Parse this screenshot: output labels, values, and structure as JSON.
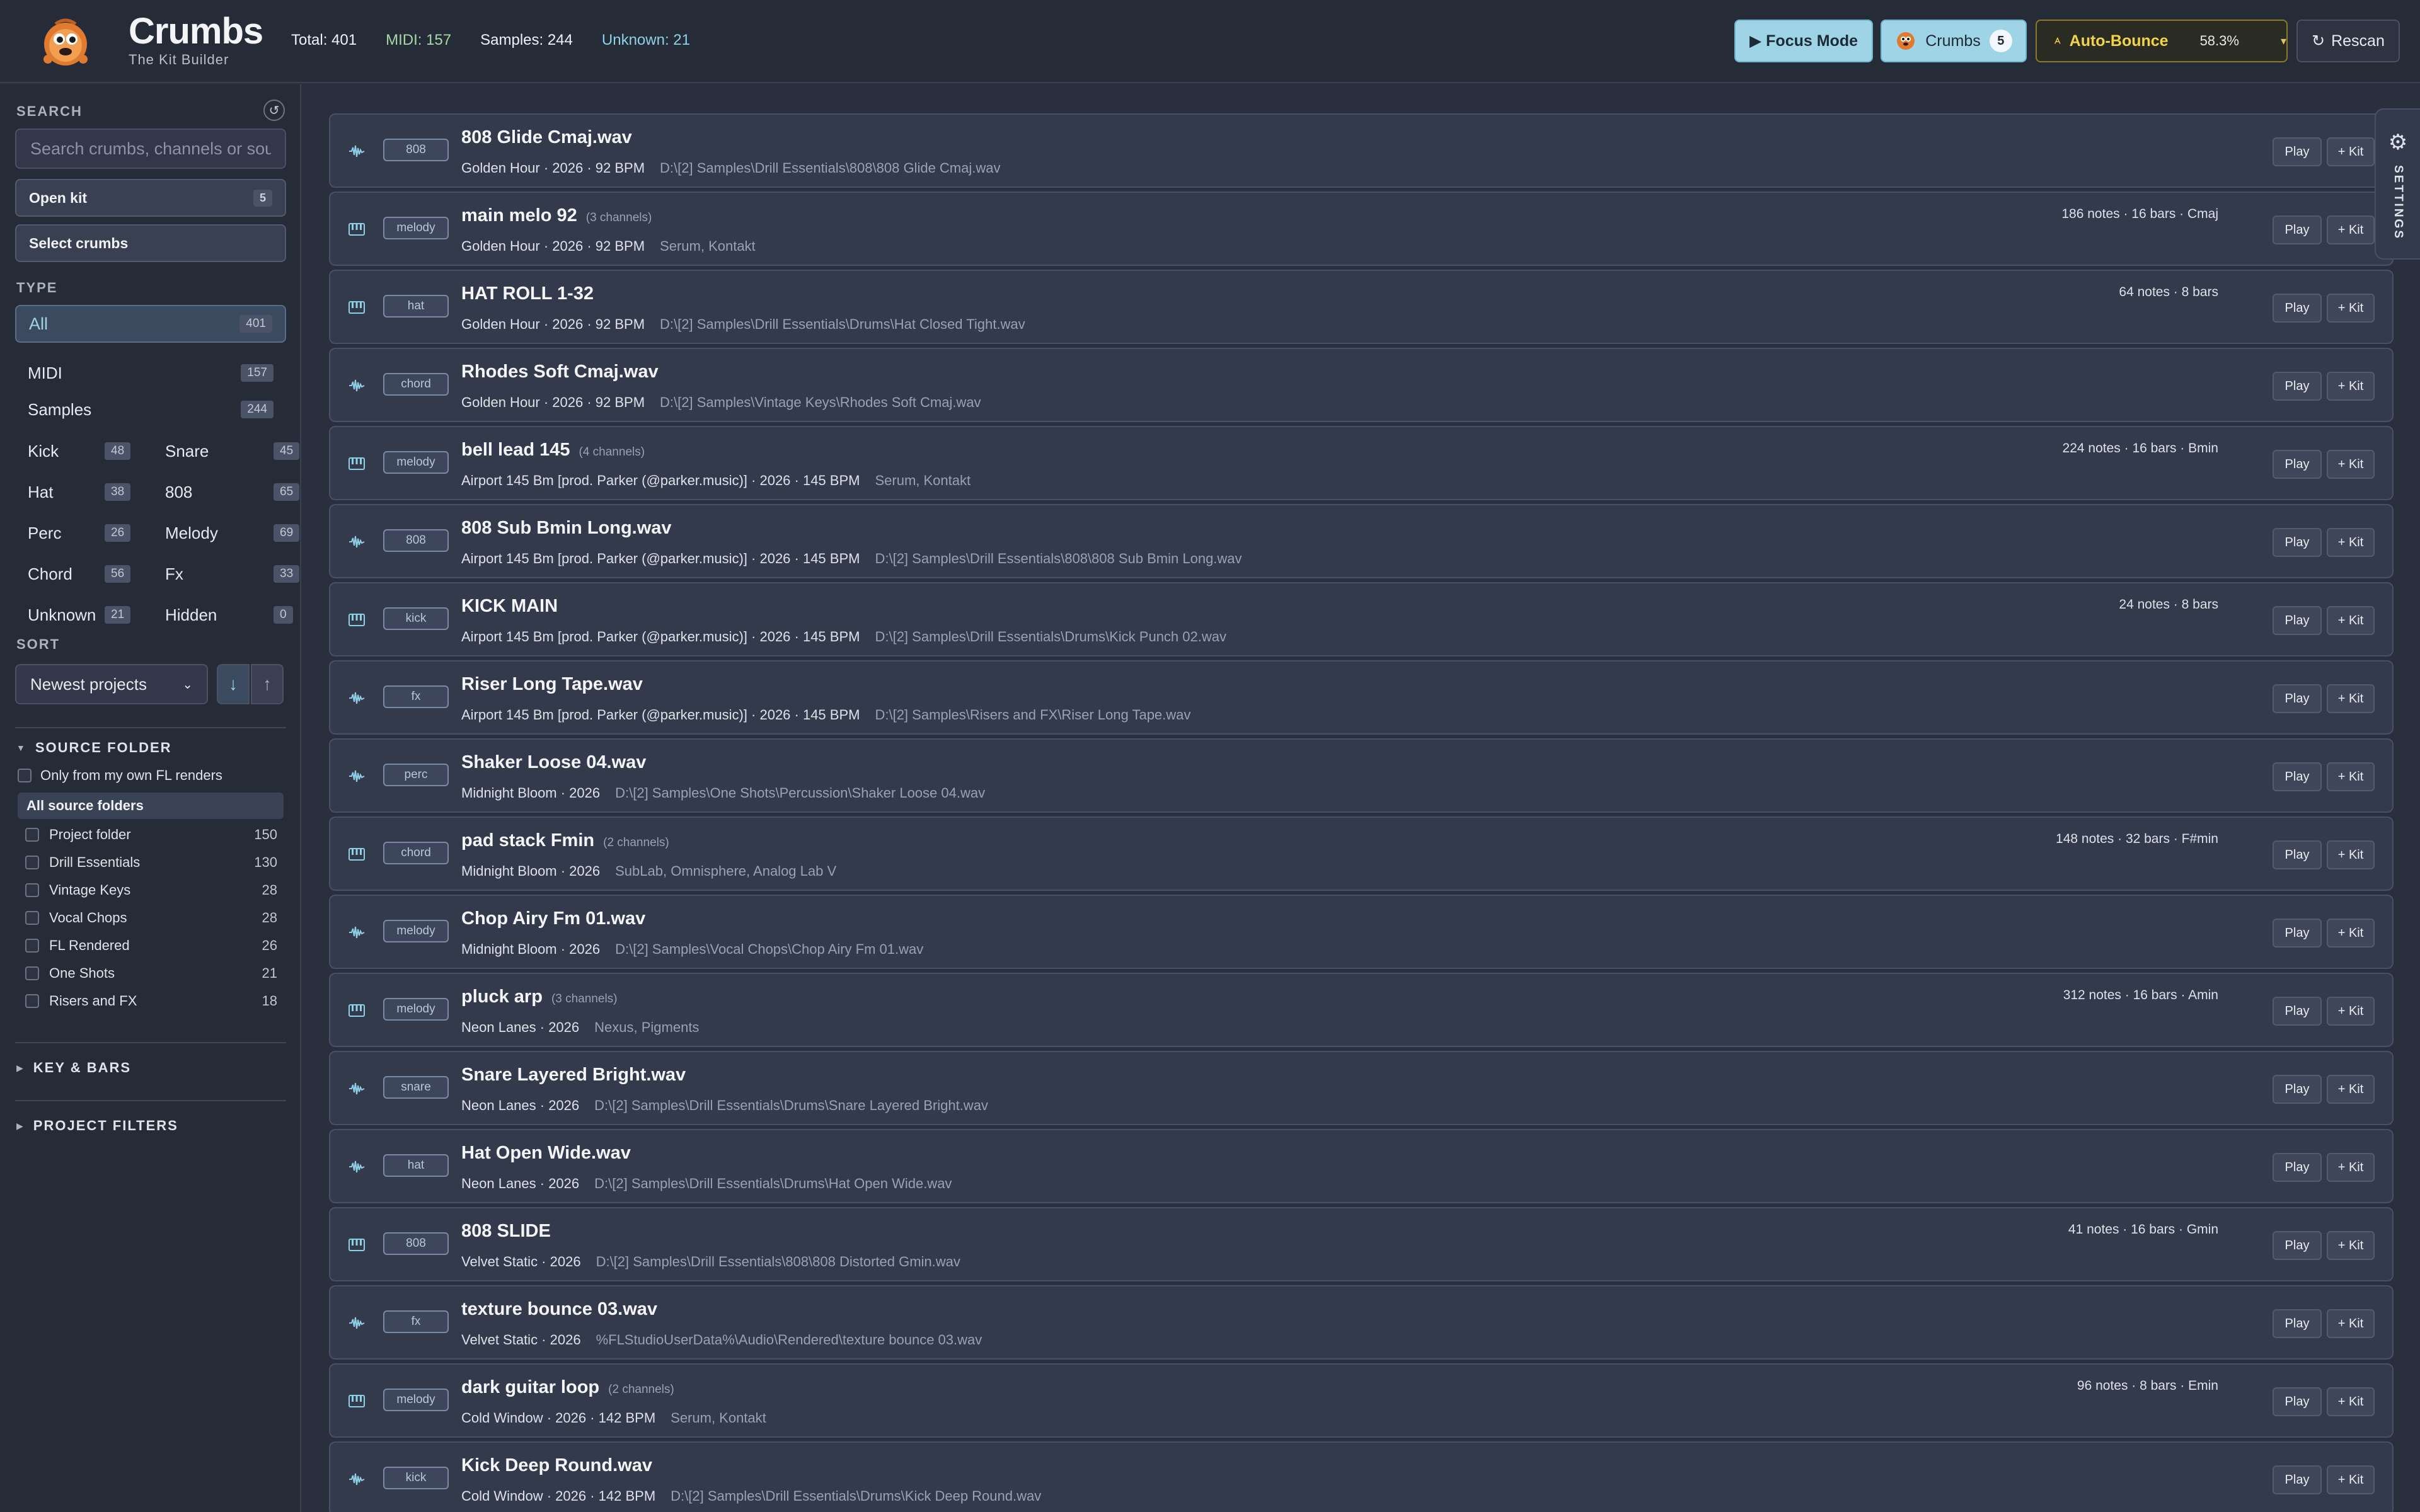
{
  "header": {
    "title": "Crumbs",
    "subtitle": "The Kit Builder",
    "stats": {
      "total": "Total: 401",
      "midi": "MIDI: 157",
      "samples": "Samples: 244",
      "unknown": "Unknown: 21"
    },
    "focus_label": "▶ Focus Mode",
    "crumbs_label": "Crumbs",
    "crumbs_count": "5",
    "bounce_label": "Auto-Bounce",
    "bounce_pct": "58.3%",
    "rescan_label": "Rescan"
  },
  "sidebar": {
    "search_label": "SEARCH",
    "search_placeholder": "Search crumbs, channels or sour",
    "open_kit_label": "Open kit",
    "open_kit_count": "5",
    "select_crumbs_label": "Select crumbs",
    "type_label": "TYPE",
    "type_all": {
      "label": "All",
      "count": "401"
    },
    "types_single": [
      {
        "label": "MIDI",
        "count": "157"
      },
      {
        "label": "Samples",
        "count": "244"
      }
    ],
    "types_grid": [
      {
        "label": "Kick",
        "count": "48"
      },
      {
        "label": "Snare",
        "count": "45"
      },
      {
        "label": "Hat",
        "count": "38"
      },
      {
        "label": "808",
        "count": "65"
      },
      {
        "label": "Perc",
        "count": "26"
      },
      {
        "label": "Melody",
        "count": "69"
      },
      {
        "label": "Chord",
        "count": "56"
      },
      {
        "label": "Fx",
        "count": "33"
      },
      {
        "label": "Unknown",
        "count": "21"
      },
      {
        "label": "Hidden",
        "count": "0"
      }
    ],
    "sort_label": "SORT",
    "sort_value": "Newest projects",
    "source_folder_label": "SOURCE FOLDER",
    "own_renders_label": "Only from my own FL renders",
    "all_sources_label": "All source folders",
    "sources": [
      {
        "label": "Project folder",
        "count": "150"
      },
      {
        "label": "Drill Essentials",
        "count": "130"
      },
      {
        "label": "Vintage Keys",
        "count": "28"
      },
      {
        "label": "Vocal Chops",
        "count": "28"
      },
      {
        "label": "FL Rendered",
        "count": "26"
      },
      {
        "label": "One Shots",
        "count": "21"
      },
      {
        "label": "Risers and FX",
        "count": "18"
      }
    ],
    "key_bars_label": "KEY & BARS",
    "project_filters_label": "PROJECT FILTERS"
  },
  "settings_label": "SETTINGS",
  "play_label": "Play",
  "kit_label": "+ Kit",
  "rows": [
    {
      "kind": "sample",
      "tag": "808",
      "title": "808 Glide Cmaj.wav",
      "channels": "",
      "meta": "Golden Hour · 2026 · 92 BPM",
      "path": "D:\\[2] Samples\\Drill Essentials\\808\\808 Glide Cmaj.wav",
      "notes": ""
    },
    {
      "kind": "midi",
      "tag": "melody",
      "title": "main melo 92",
      "channels": "(3 channels)",
      "meta": "Golden Hour · 2026 · 92 BPM",
      "path": "Serum, Kontakt",
      "notes": "186 notes · 16 bars · Cmaj"
    },
    {
      "kind": "midi",
      "tag": "hat",
      "title": "HAT ROLL 1-32",
      "channels": "",
      "meta": "Golden Hour · 2026 · 92 BPM",
      "path": "D:\\[2] Samples\\Drill Essentials\\Drums\\Hat Closed Tight.wav",
      "notes": "64 notes · 8 bars"
    },
    {
      "kind": "sample",
      "tag": "chord",
      "title": "Rhodes Soft Cmaj.wav",
      "channels": "",
      "meta": "Golden Hour · 2026 · 92 BPM",
      "path": "D:\\[2] Samples\\Vintage Keys\\Rhodes Soft Cmaj.wav",
      "notes": ""
    },
    {
      "kind": "midi",
      "tag": "melody",
      "title": "bell lead 145",
      "channels": "(4 channels)",
      "meta": "Airport 145 Bm [prod. Parker (@parker.music)] · 2026 · 145 BPM",
      "path": "Serum, Kontakt",
      "notes": "224 notes · 16 bars · Bmin"
    },
    {
      "kind": "sample",
      "tag": "808",
      "title": "808 Sub Bmin Long.wav",
      "channels": "",
      "meta": "Airport 145 Bm [prod. Parker (@parker.music)] · 2026 · 145 BPM",
      "path": "D:\\[2] Samples\\Drill Essentials\\808\\808 Sub Bmin Long.wav",
      "notes": ""
    },
    {
      "kind": "midi",
      "tag": "kick",
      "title": "KICK MAIN",
      "channels": "",
      "meta": "Airport 145 Bm [prod. Parker (@parker.music)] · 2026 · 145 BPM",
      "path": "D:\\[2] Samples\\Drill Essentials\\Drums\\Kick Punch 02.wav",
      "notes": "24 notes · 8 bars"
    },
    {
      "kind": "sample",
      "tag": "fx",
      "title": "Riser Long Tape.wav",
      "channels": "",
      "meta": "Airport 145 Bm [prod. Parker (@parker.music)] · 2026 · 145 BPM",
      "path": "D:\\[2] Samples\\Risers and FX\\Riser Long Tape.wav",
      "notes": ""
    },
    {
      "kind": "sample",
      "tag": "perc",
      "title": "Shaker Loose 04.wav",
      "channels": "",
      "meta": "Midnight Bloom · 2026",
      "path": "D:\\[2] Samples\\One Shots\\Percussion\\Shaker Loose 04.wav",
      "notes": ""
    },
    {
      "kind": "midi",
      "tag": "chord",
      "title": "pad stack Fmin",
      "channels": "(2 channels)",
      "meta": "Midnight Bloom · 2026",
      "path": "SubLab, Omnisphere, Analog Lab V",
      "notes": "148 notes · 32 bars · F#min"
    },
    {
      "kind": "sample",
      "tag": "melody",
      "title": "Chop Airy Fm 01.wav",
      "channels": "",
      "meta": "Midnight Bloom · 2026",
      "path": "D:\\[2] Samples\\Vocal Chops\\Chop Airy Fm 01.wav",
      "notes": ""
    },
    {
      "kind": "midi",
      "tag": "melody",
      "title": "pluck arp",
      "channels": "(3 channels)",
      "meta": "Neon Lanes · 2026",
      "path": "Nexus, Pigments",
      "notes": "312 notes · 16 bars · Amin"
    },
    {
      "kind": "sample",
      "tag": "snare",
      "title": "Snare Layered Bright.wav",
      "channels": "",
      "meta": "Neon Lanes · 2026",
      "path": "D:\\[2] Samples\\Drill Essentials\\Drums\\Snare Layered Bright.wav",
      "notes": ""
    },
    {
      "kind": "sample",
      "tag": "hat",
      "title": "Hat Open Wide.wav",
      "channels": "",
      "meta": "Neon Lanes · 2026",
      "path": "D:\\[2] Samples\\Drill Essentials\\Drums\\Hat Open Wide.wav",
      "notes": ""
    },
    {
      "kind": "midi",
      "tag": "808",
      "title": "808 SLIDE",
      "channels": "",
      "meta": "Velvet Static · 2026",
      "path": "D:\\[2] Samples\\Drill Essentials\\808\\808 Distorted Gmin.wav",
      "notes": "41 notes · 16 bars · Gmin"
    },
    {
      "kind": "sample",
      "tag": "fx",
      "title": "texture bounce 03.wav",
      "channels": "",
      "meta": "Velvet Static · 2026",
      "path": "%FLStudioUserData%\\Audio\\Rendered\\texture bounce 03.wav",
      "notes": ""
    },
    {
      "kind": "midi",
      "tag": "melody",
      "title": "dark guitar loop",
      "channels": "(2 channels)",
      "meta": "Cold Window · 2026 · 142 BPM",
      "path": "Serum, Kontakt",
      "notes": "96 notes · 8 bars · Emin"
    },
    {
      "kind": "sample",
      "tag": "kick",
      "title": "Kick Deep Round.wav",
      "channels": "",
      "meta": "Cold Window · 2026 · 142 BPM",
      "path": "D:\\[2] Samples\\Drill Essentials\\Drums\\Kick Deep Round.wav",
      "notes": ""
    }
  ]
}
